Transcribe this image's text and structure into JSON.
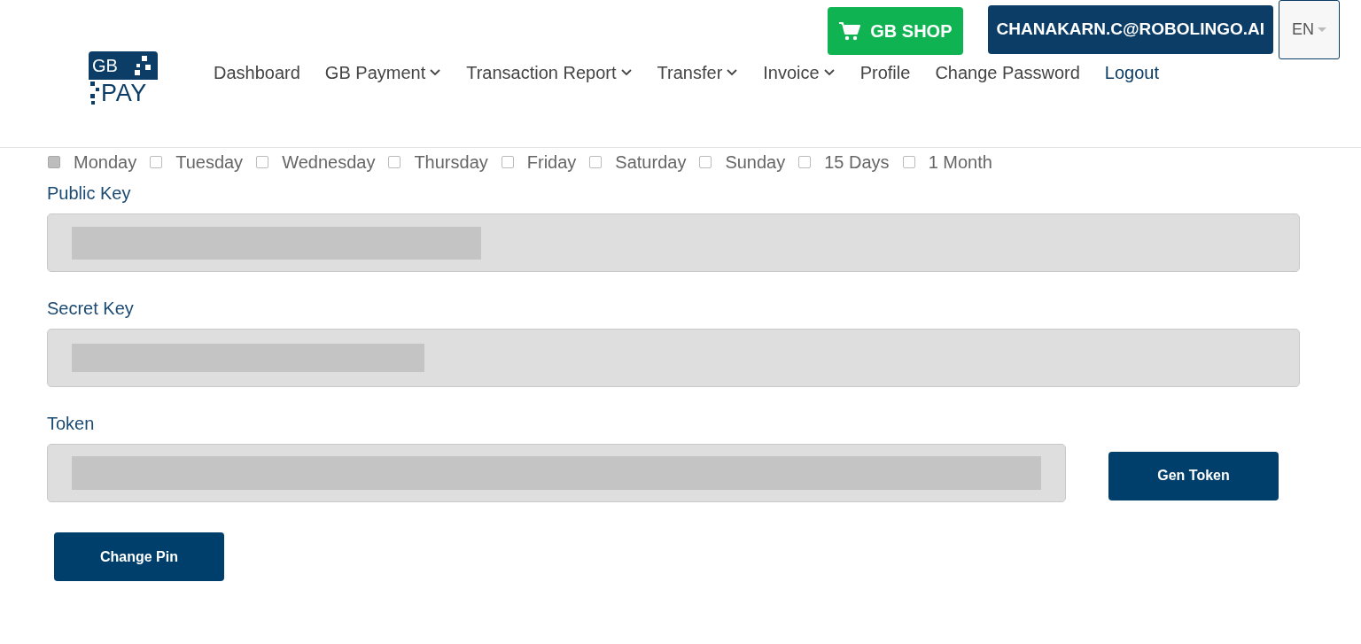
{
  "logo": {
    "top": "GB",
    "bottom": "PAY"
  },
  "shop_button": "GB SHOP",
  "account_button": "CHANAKARN.C@ROBOLINGO.AI",
  "language": "EN",
  "nav": [
    {
      "label": "Dashboard",
      "kind": "link"
    },
    {
      "label": "GB Payment",
      "kind": "dropdown"
    },
    {
      "label": "Transaction Report",
      "kind": "dropdown"
    },
    {
      "label": "Transfer",
      "kind": "dropdown"
    },
    {
      "label": "Invoice",
      "kind": "dropdown"
    },
    {
      "label": "Profile",
      "kind": "link"
    },
    {
      "label": "Change Password",
      "kind": "link"
    },
    {
      "label": "Logout",
      "kind": "accent"
    }
  ],
  "schedule": [
    {
      "label": "Monday",
      "checked": true
    },
    {
      "label": "Tuesday",
      "checked": false
    },
    {
      "label": "Wednesday",
      "checked": false
    },
    {
      "label": "Thursday",
      "checked": false
    },
    {
      "label": "Friday",
      "checked": false
    },
    {
      "label": "Saturday",
      "checked": false
    },
    {
      "label": "Sunday",
      "checked": false
    },
    {
      "label": "15 Days",
      "checked": false
    },
    {
      "label": "1 Month",
      "checked": false
    }
  ],
  "fields": [
    {
      "label": "Public Key"
    },
    {
      "label": "Secret Key"
    },
    {
      "label": "Token",
      "action": "Gen Token"
    }
  ],
  "change_pin_button": "Change Pin"
}
